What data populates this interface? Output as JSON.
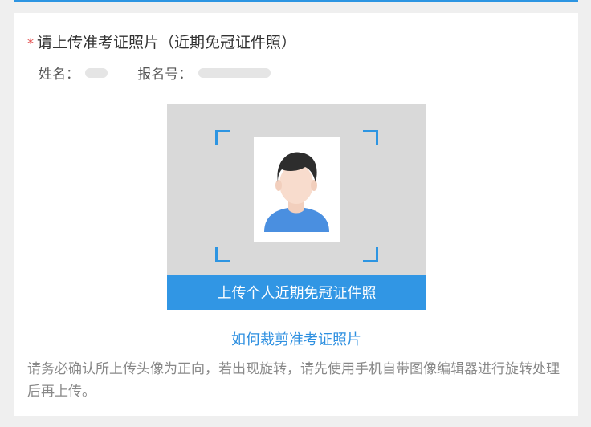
{
  "colors": {
    "accent": "#2d95e2",
    "button": "#3196e4",
    "required_star": "#e24b4b",
    "link": "#2d8fe0"
  },
  "form": {
    "required_mark": "*",
    "title": "请上传准考证照片（近期免冠证件照）",
    "name_label": "姓名：",
    "reg_no_label": "报名号："
  },
  "upload": {
    "button_label": "上传个人近期免冠证件照",
    "placeholder_icon": "person-portrait-icon"
  },
  "help": {
    "link_text": "如何裁剪准考证照片",
    "note": "请务必确认所上传头像为正向，若出现旋转，请先使用手机自带图像编辑器进行旋转处理后再上传。"
  }
}
